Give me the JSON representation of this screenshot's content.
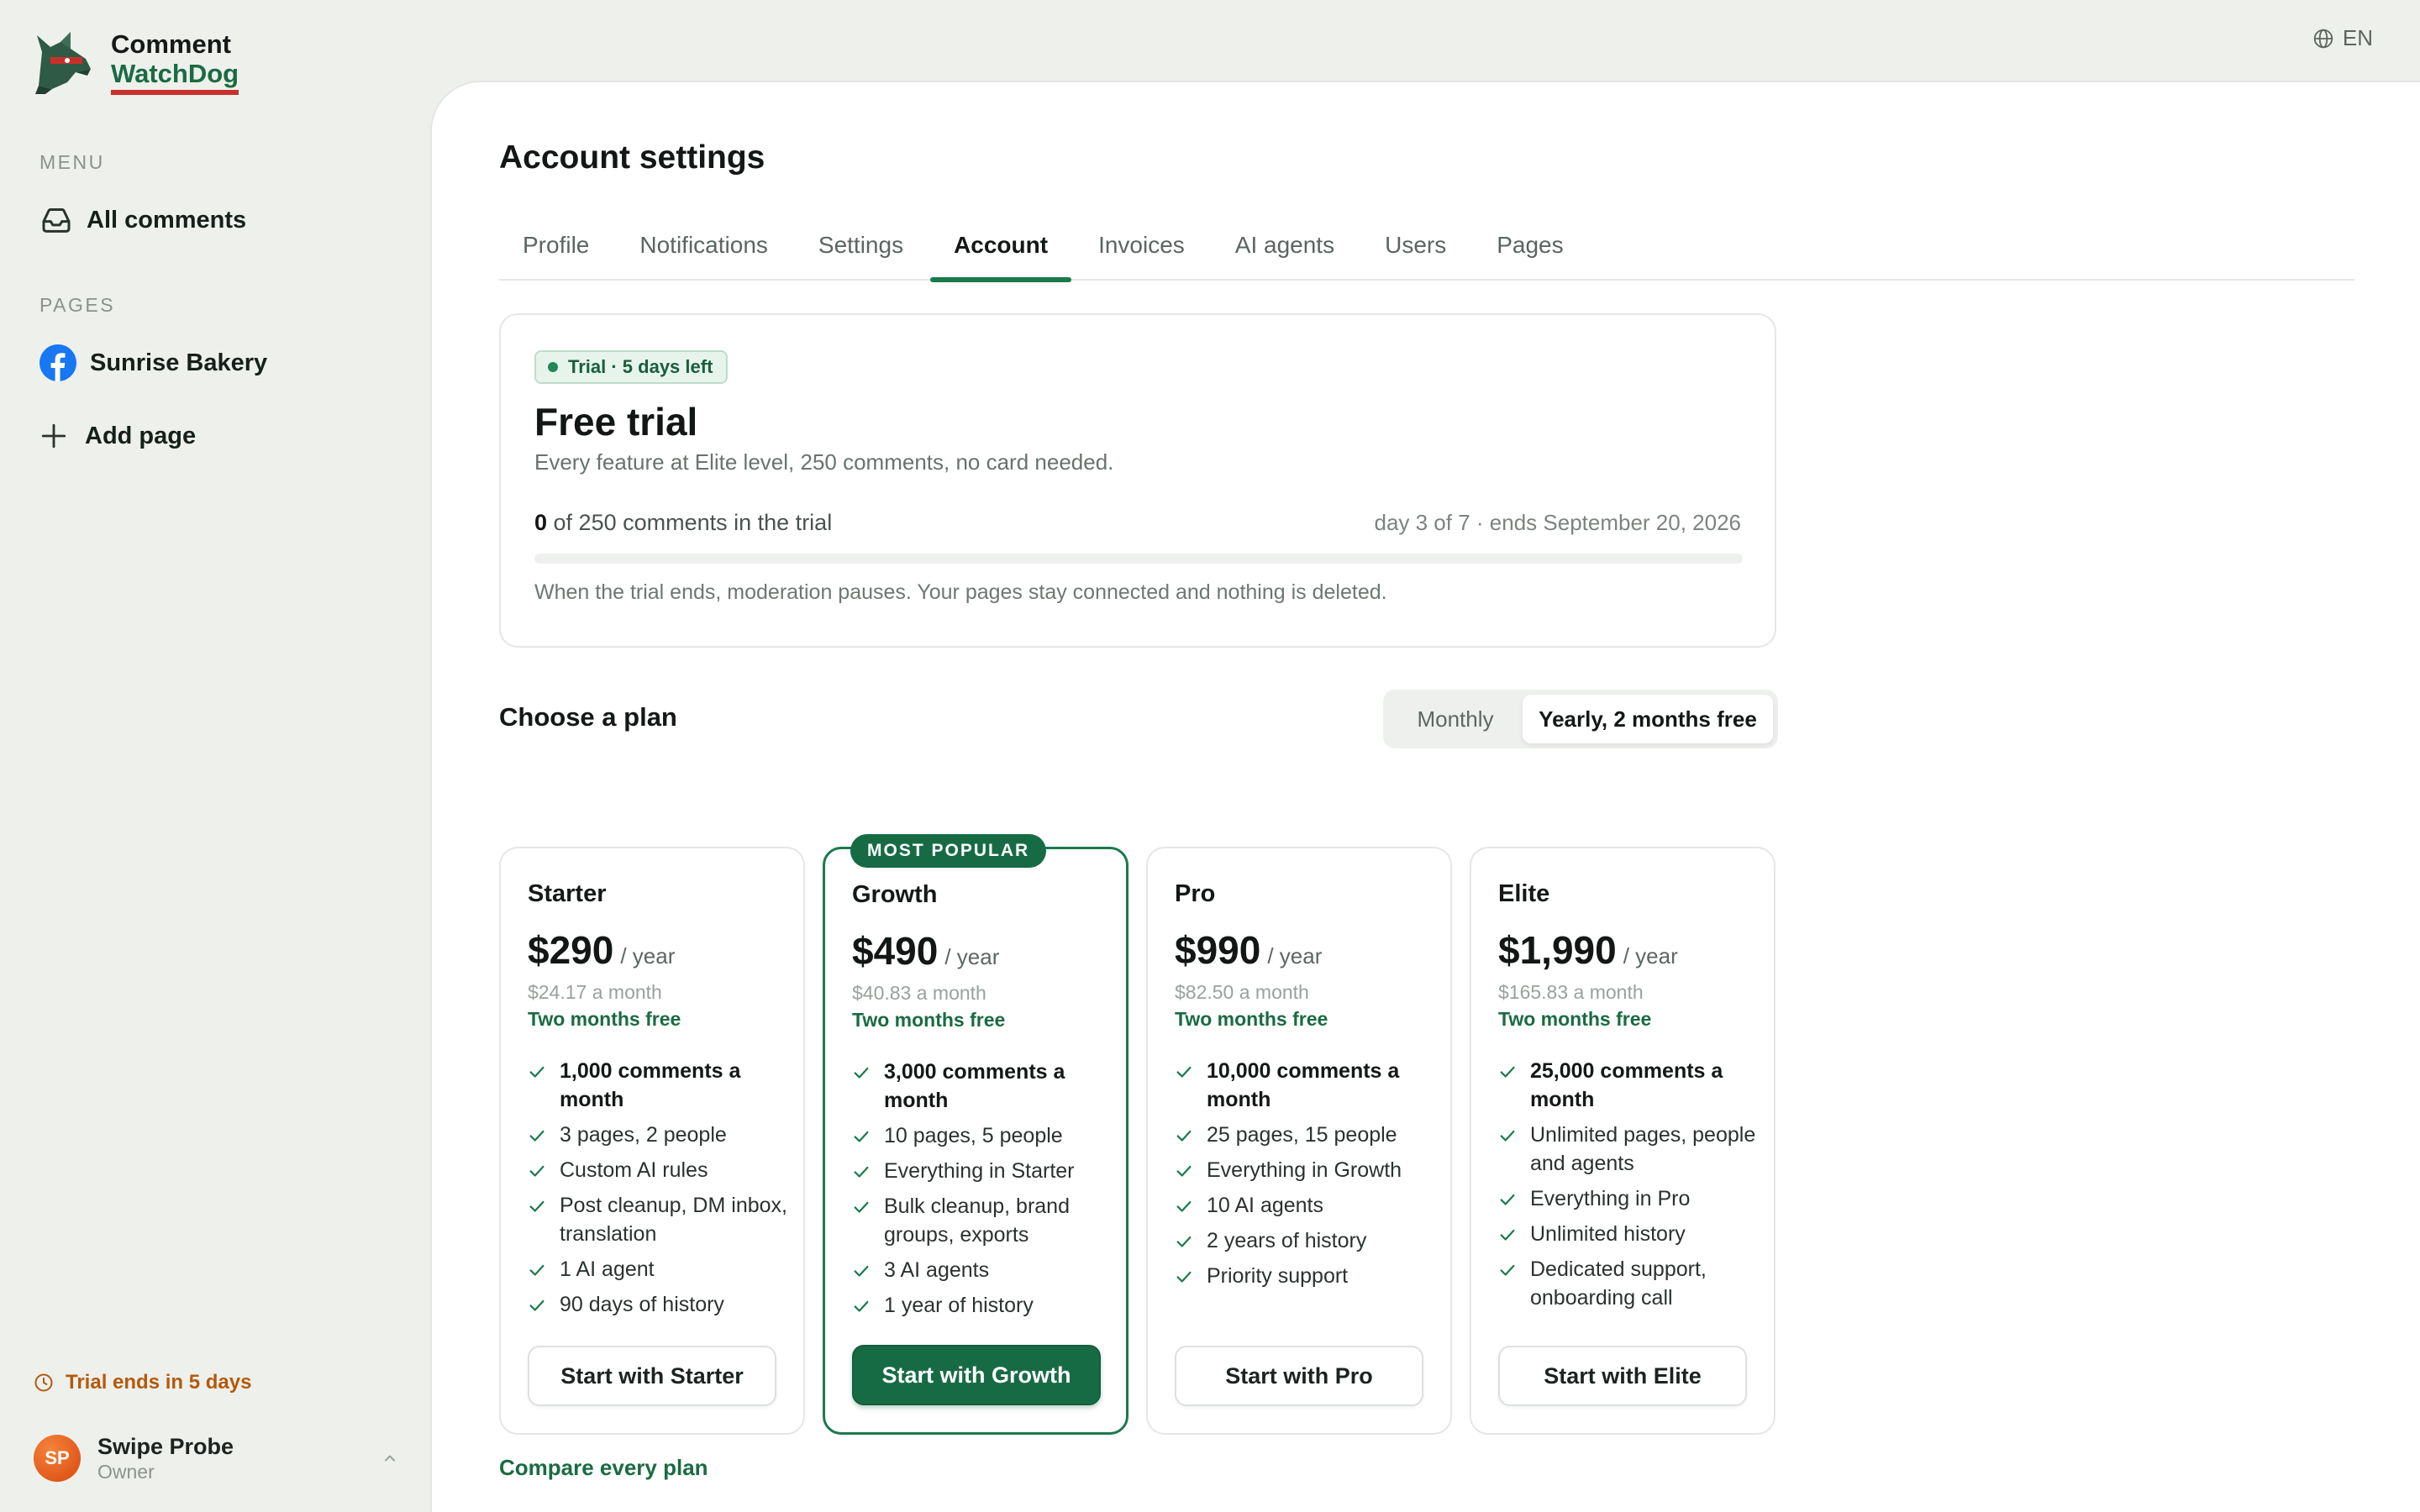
{
  "app": {
    "name_line1": "Comment",
    "name_line2": "WatchDog",
    "language": "EN"
  },
  "sidebar": {
    "menu_heading": "MENU",
    "menu_items": [
      {
        "label": "All comments",
        "icon": "inbox-icon"
      }
    ],
    "pages_heading": "PAGES",
    "pages": [
      {
        "label": "Sunrise Bakery",
        "icon": "facebook-icon"
      }
    ],
    "add_page_label": "Add page",
    "trial_notice": "Trial ends in 5 days",
    "user": {
      "initials": "SP",
      "name": "Swipe Probe",
      "role": "Owner"
    }
  },
  "main": {
    "title": "Account settings",
    "tabs": [
      "Profile",
      "Notifications",
      "Settings",
      "Account",
      "Invoices",
      "AI agents",
      "Users",
      "Pages"
    ],
    "active_tab": "Account"
  },
  "trial": {
    "badge": "Trial · 5 days left",
    "title": "Free trial",
    "subtitle": "Every feature at Elite level, 250 comments, no card needed.",
    "used": "0",
    "usage_text": " of 250 comments in the trial",
    "progress_fraction": 0,
    "days_text": "day 3 of 7 · ends September 20, 2026",
    "note": "When the trial ends, moderation pauses. Your pages stay connected and nothing is deleted."
  },
  "plans_section": {
    "heading": "Choose a plan",
    "billing_options": [
      "Monthly",
      "Yearly, 2 months free"
    ],
    "selected_billing": "Yearly, 2 months free",
    "popular_tag": "MOST POPULAR",
    "compare_link": "Compare every plan"
  },
  "plans": [
    {
      "name": "Starter",
      "price": "$290",
      "period": "/ year",
      "monthly": "$24.17 a month",
      "free": "Two months free",
      "features": [
        "1,000 comments a month",
        "3 pages, 2 people",
        "Custom AI rules",
        "Post cleanup, DM inbox, translation",
        "1 AI agent",
        "90 days of history"
      ],
      "button": "Start with Starter"
    },
    {
      "name": "Growth",
      "price": "$490",
      "period": "/ year",
      "monthly": "$40.83 a month",
      "free": "Two months free",
      "features": [
        "3,000 comments a month",
        "10 pages, 5 people",
        "Everything in Starter",
        "Bulk cleanup, brand groups, exports",
        "3 AI agents",
        "1 year of history"
      ],
      "button": "Start with Growth"
    },
    {
      "name": "Pro",
      "price": "$990",
      "period": "/ year",
      "monthly": "$82.50 a month",
      "free": "Two months free",
      "features": [
        "10,000 comments a month",
        "25 pages, 15 people",
        "Everything in Growth",
        "10 AI agents",
        "2 years of history",
        "Priority support"
      ],
      "button": "Start with Pro"
    },
    {
      "name": "Elite",
      "price": "$1,990",
      "period": "/ year",
      "monthly": "$165.83 a month",
      "free": "Two months free",
      "features": [
        "25,000 comments a month",
        "Unlimited pages, people and agents",
        "Everything in Pro",
        "Unlimited history",
        "Dedicated support, onboarding call"
      ],
      "button": "Start with Elite"
    }
  ],
  "colors": {
    "accent": "#1a7a4c",
    "warning": "#b45a0c",
    "brand_red": "#c9302c"
  }
}
